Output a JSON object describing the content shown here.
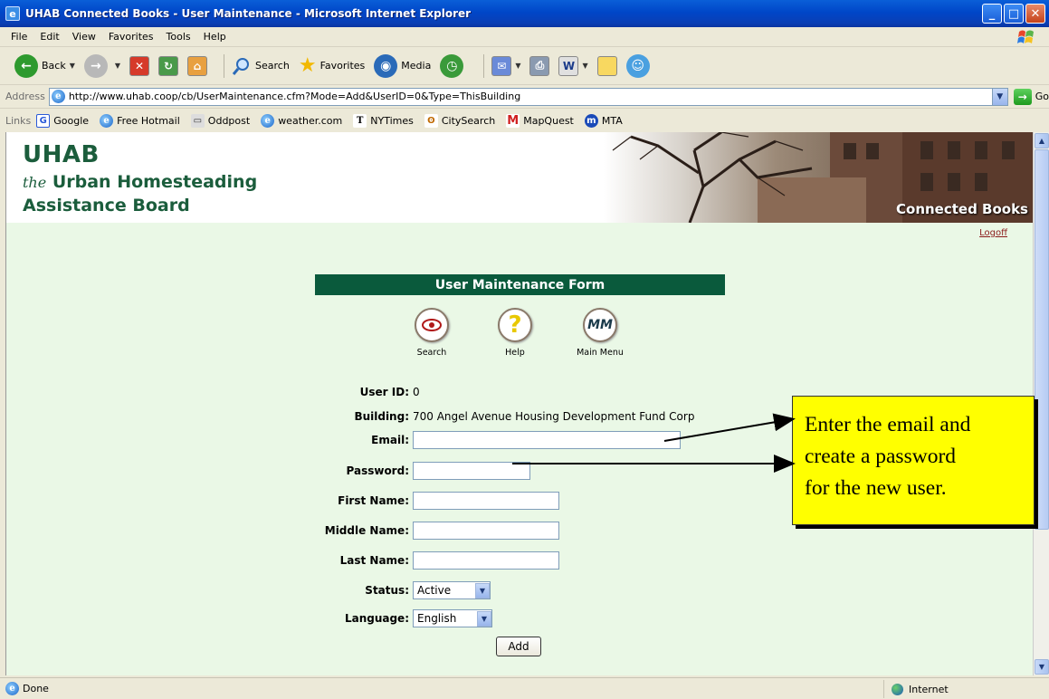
{
  "window": {
    "title": "UHAB Connected Books - User Maintenance - Microsoft Internet Explorer",
    "minimize": "_",
    "maximize": "□",
    "close": "✕"
  },
  "menu": [
    "File",
    "Edit",
    "View",
    "Favorites",
    "Tools",
    "Help"
  ],
  "toolbar": {
    "back": "Back",
    "search": "Search",
    "favorites": "Favorites",
    "media": "Media"
  },
  "address": {
    "label": "Address",
    "url": "http://www.uhab.coop/cb/UserMaintenance.cfm?Mode=Add&UserID=0&Type=ThisBuilding",
    "go": "Go"
  },
  "links": {
    "label": "Links",
    "items": [
      "Google",
      "Free Hotmail",
      "Oddpost",
      "weather.com",
      "NYTimes",
      "CitySearch",
      "MapQuest",
      "MTA"
    ]
  },
  "site": {
    "logo_line1": "UHAB",
    "logo_the": "the",
    "logo_line2": "Urban Homesteading",
    "logo_line3": "Assistance Board",
    "banner_label": "Connected Books",
    "logoff": "Logoff"
  },
  "form": {
    "heading": "User Maintenance Form",
    "nav": [
      {
        "label": "Search",
        "icon": "eye-icon"
      },
      {
        "label": "Help",
        "icon": "question-icon"
      },
      {
        "label": "Main Menu",
        "icon": "MM"
      }
    ],
    "user_id_label": "User ID:",
    "user_id_value": "0",
    "building_label": "Building:",
    "building_value": "700 Angel Avenue Housing Development Fund Corp",
    "email_label": "Email:",
    "password_label": "Password:",
    "first_name_label": "First Name:",
    "middle_name_label": "Middle Name:",
    "last_name_label": "Last Name:",
    "status_label": "Status:",
    "status_value": "Active",
    "language_label": "Language:",
    "language_value": "English",
    "add_button": "Add"
  },
  "callout": {
    "line1": "Enter the email and",
    "line2": "create a password",
    "line3": "for the new user.",
    "background": "#ffff00"
  },
  "status": {
    "text": "Done",
    "zone": "Internet"
  },
  "colors": {
    "form_header": "#0a5a3c",
    "logo": "#1b5d3c",
    "content_bg": "#eaf8e6"
  }
}
